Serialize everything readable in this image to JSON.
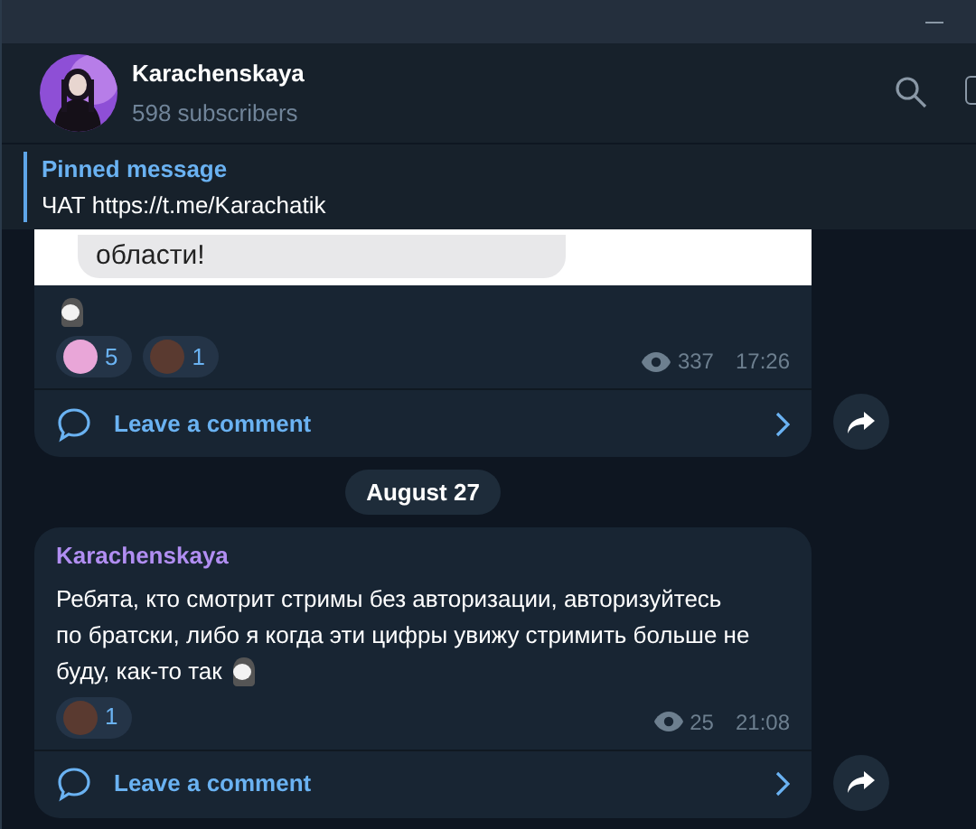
{
  "channel": {
    "name": "Karachenskaya",
    "subtitle": "598 subscribers"
  },
  "pinned": {
    "label": "Pinned message",
    "text": "ЧАТ https://t.me/Karachatik"
  },
  "messages": [
    {
      "image_text": "области!",
      "sticker": true,
      "reactions": [
        {
          "count": "5",
          "color": "#e9a6d8"
        },
        {
          "count": "1",
          "color": "#5a3a30"
        }
      ],
      "views": "337",
      "time": "17:26",
      "comment": "Leave a comment"
    },
    {
      "kind": "date",
      "text": "August 27"
    },
    {
      "kind": "text",
      "author": "Karachenskaya",
      "text": "Ребята, кто смотрит стримы без авторизации, авторизуйтесь по братски, либо я когда эти цифры увижу стримить больше не буду, как-то так",
      "sticker": true,
      "reactions": [
        {
          "count": "1",
          "color": "#5a3a30"
        }
      ],
      "views": "25",
      "time": "21:08",
      "comment": "Leave a comment"
    }
  ]
}
